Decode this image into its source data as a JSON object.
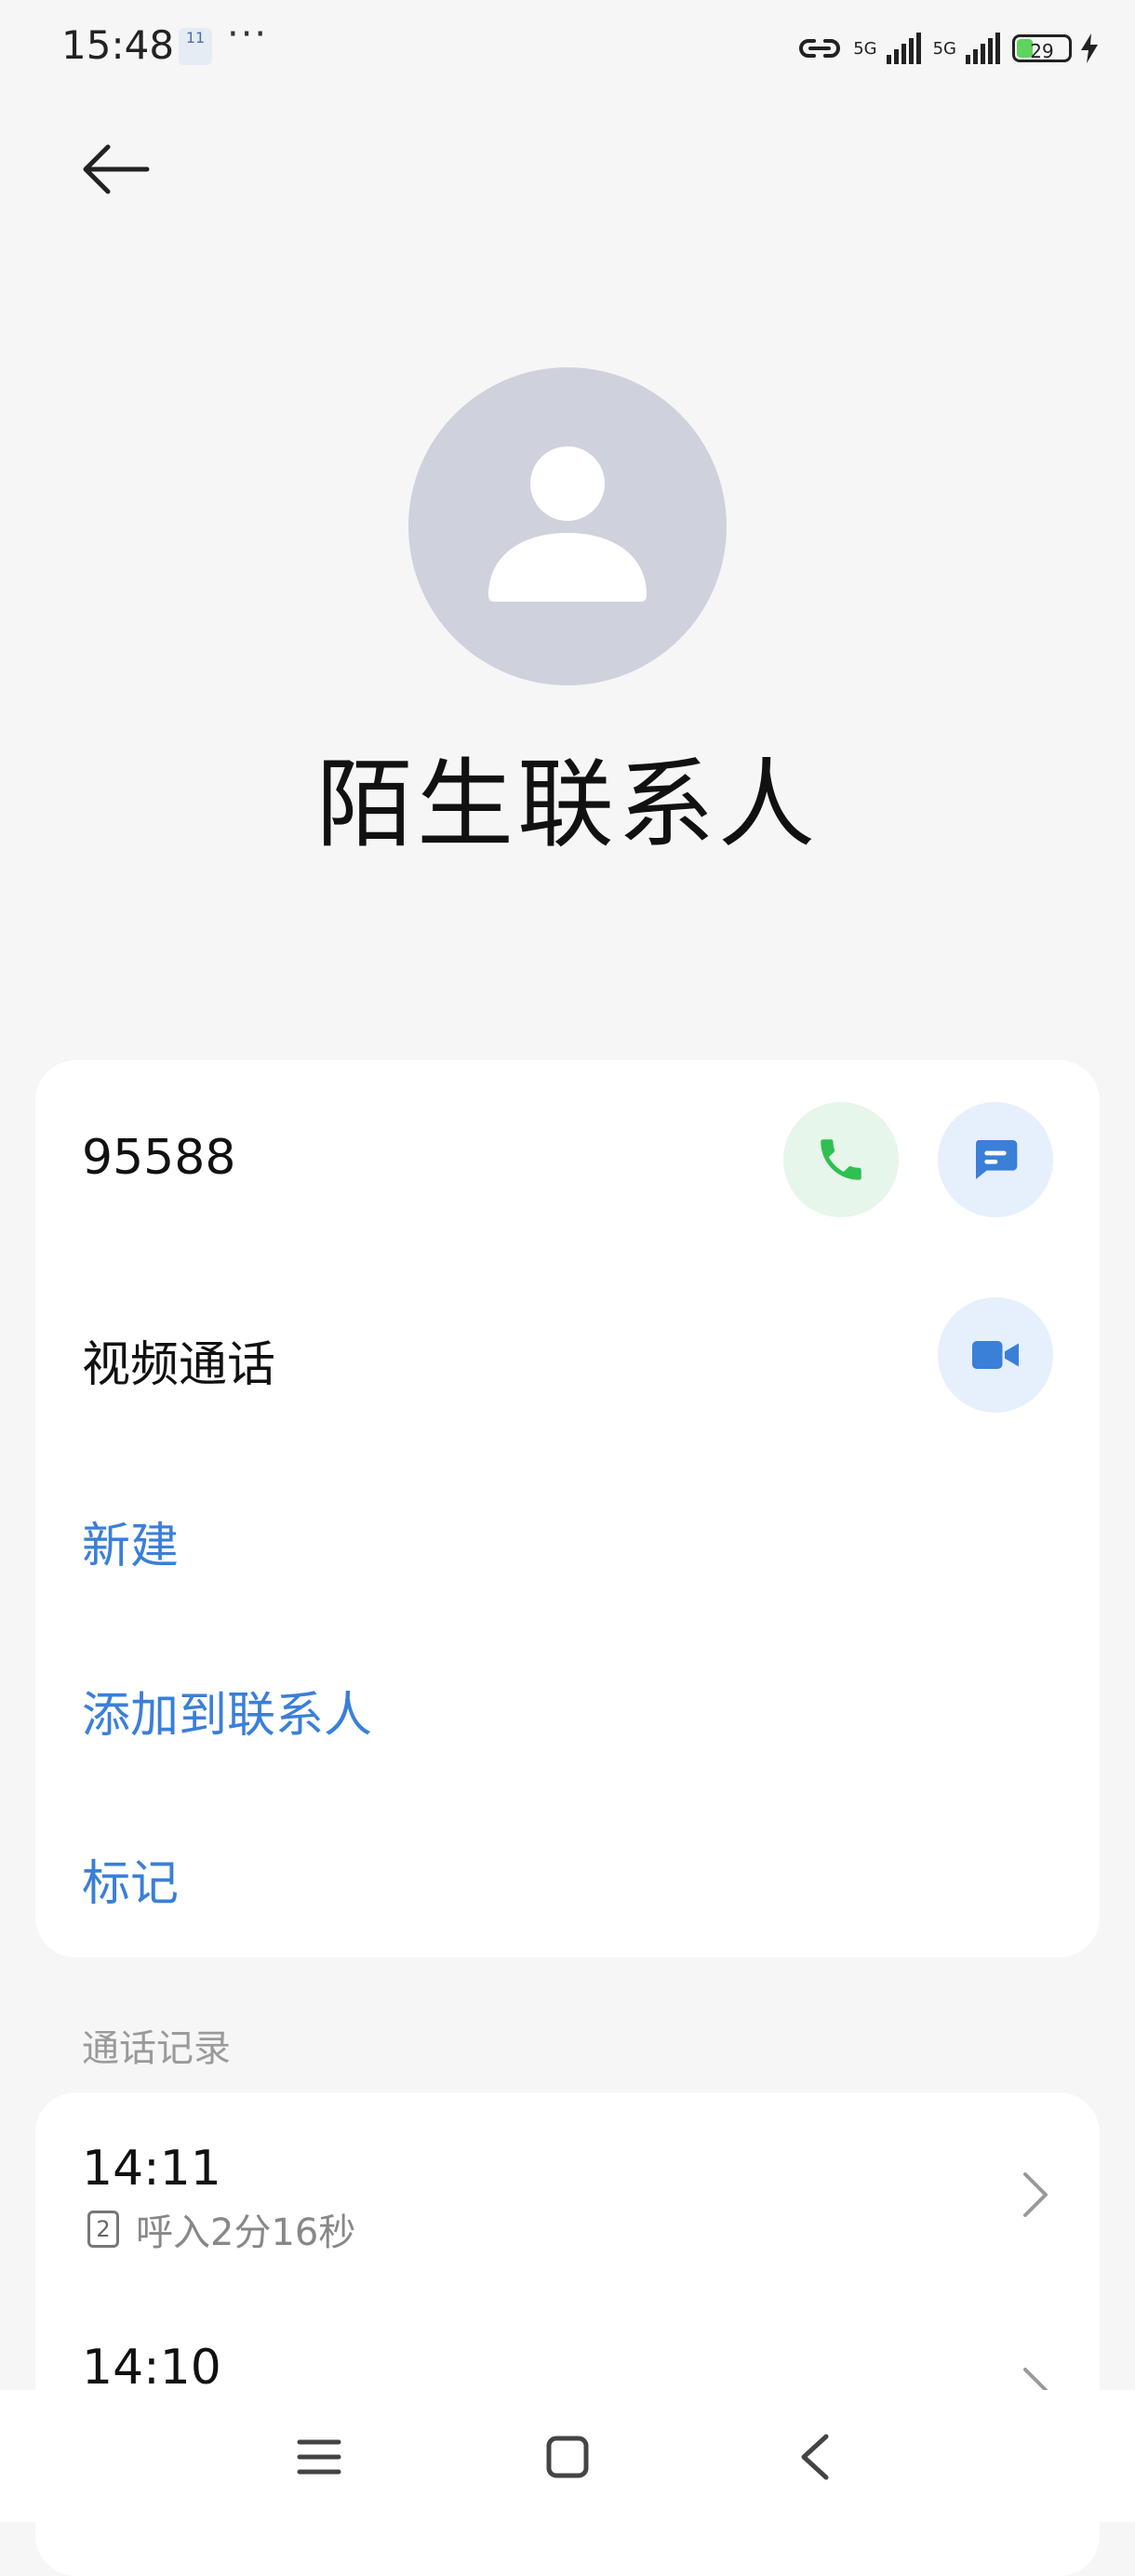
{
  "status_bar": {
    "time": "15:48",
    "notification_badge": "11",
    "more": "···",
    "signal1": "5G",
    "signal2": "5G",
    "battery": "29"
  },
  "contact": {
    "name": "陌生联系人",
    "number": "95588"
  },
  "actions": {
    "video_call": "视频通话",
    "new": "新建",
    "add_to_contacts": "添加到联系人",
    "mark": "标记"
  },
  "call_log": {
    "section_title": "通话记录",
    "entries": [
      {
        "time": "14:11",
        "sim": "2",
        "detail": "呼入2分16秒"
      },
      {
        "time": "14:10"
      }
    ]
  },
  "colors": {
    "accent": "#3a7fd8",
    "call_green": "#2fbf52",
    "avatar": "#cfd1dc"
  }
}
